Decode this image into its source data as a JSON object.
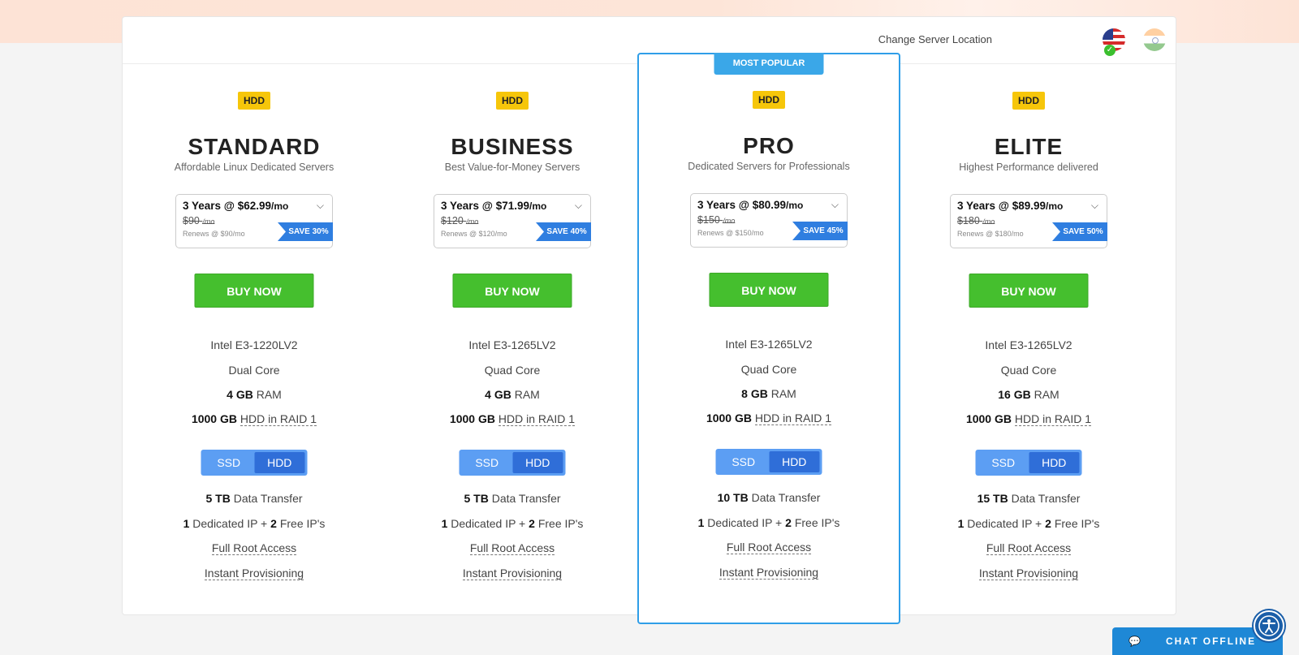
{
  "location": {
    "label": "Change Server Location"
  },
  "popular_label": "MOST POPULAR",
  "plans": [
    {
      "badge": "HDD",
      "name": "STANDARD",
      "subtitle": "Affordable Linux Dedicated Servers",
      "term_price": "3 Years @ $62.99",
      "term_unit": "/mo",
      "old_price": "$90",
      "old_unit": "/mo",
      "renews": "Renews @ $90/mo",
      "save": "SAVE 30%",
      "buy": "BUY NOW",
      "cpu": "Intel E3-1220LV2",
      "cores": "Dual Core",
      "ram_value": "4 GB",
      "ram_label": "RAM",
      "disk_value": "1000 GB",
      "disk_label": "HDD in RAID 1",
      "toggle": [
        "SSD",
        "HDD"
      ],
      "transfer_value": "5 TB",
      "transfer_label": "Data Transfer",
      "ip_dedicated": "1",
      "ip_dedicated_label": "Dedicated IP +",
      "ip_free": "2",
      "ip_free_label": "Free IP's",
      "root": "Full Root Access",
      "provisioning": "Instant Provisioning"
    },
    {
      "badge": "HDD",
      "name": "BUSINESS",
      "subtitle": "Best Value-for-Money Servers",
      "term_price": "3 Years @ $71.99",
      "term_unit": "/mo",
      "old_price": "$120",
      "old_unit": "/mo",
      "renews": "Renews @ $120/mo",
      "save": "SAVE 40%",
      "buy": "BUY NOW",
      "cpu": "Intel E3-1265LV2",
      "cores": "Quad Core",
      "ram_value": "4 GB",
      "ram_label": "RAM",
      "disk_value": "1000 GB",
      "disk_label": "HDD in RAID 1",
      "toggle": [
        "SSD",
        "HDD"
      ],
      "transfer_value": "5 TB",
      "transfer_label": "Data Transfer",
      "ip_dedicated": "1",
      "ip_dedicated_label": "Dedicated IP +",
      "ip_free": "2",
      "ip_free_label": "Free IP's",
      "root": "Full Root Access",
      "provisioning": "Instant Provisioning"
    },
    {
      "badge": "HDD",
      "name": "PRO",
      "subtitle": "Dedicated Servers for Professionals",
      "term_price": "3 Years @ $80.99",
      "term_unit": "/mo",
      "old_price": "$150",
      "old_unit": "/mo",
      "renews": "Renews @ $150/mo",
      "save": "SAVE 45%",
      "buy": "BUY NOW",
      "cpu": "Intel E3-1265LV2",
      "cores": "Quad Core",
      "ram_value": "8 GB",
      "ram_label": "RAM",
      "disk_value": "1000 GB",
      "disk_label": "HDD in RAID 1",
      "toggle": [
        "SSD",
        "HDD"
      ],
      "transfer_value": "10 TB",
      "transfer_label": "Data Transfer",
      "ip_dedicated": "1",
      "ip_dedicated_label": "Dedicated IP +",
      "ip_free": "2",
      "ip_free_label": "Free IP's",
      "root": "Full Root Access",
      "provisioning": "Instant Provisioning"
    },
    {
      "badge": "HDD",
      "name": "ELITE",
      "subtitle": "Highest Performance delivered",
      "term_price": "3 Years @ $89.99",
      "term_unit": "/mo",
      "old_price": "$180",
      "old_unit": "/mo",
      "renews": "Renews @ $180/mo",
      "save": "SAVE 50%",
      "buy": "BUY NOW",
      "cpu": "Intel E3-1265LV2",
      "cores": "Quad Core",
      "ram_value": "16 GB",
      "ram_label": "RAM",
      "disk_value": "1000 GB",
      "disk_label": "HDD in RAID 1",
      "toggle": [
        "SSD",
        "HDD"
      ],
      "transfer_value": "15 TB",
      "transfer_label": "Data Transfer",
      "ip_dedicated": "1",
      "ip_dedicated_label": "Dedicated IP +",
      "ip_free": "2",
      "ip_free_label": "Free IP's",
      "root": "Full Root Access",
      "provisioning": "Instant Provisioning"
    }
  ],
  "chat": {
    "label": "CHAT OFFLINE",
    "icon": "chat-bubble-icon"
  },
  "accessibility": {
    "icon": "accessibility-icon"
  },
  "colors": {
    "buy": "#45bf2e",
    "badge": "#f6c60a",
    "save": "#2f7ee0",
    "featured_border": "#2f9ee8",
    "chat": "#1e88d6"
  }
}
